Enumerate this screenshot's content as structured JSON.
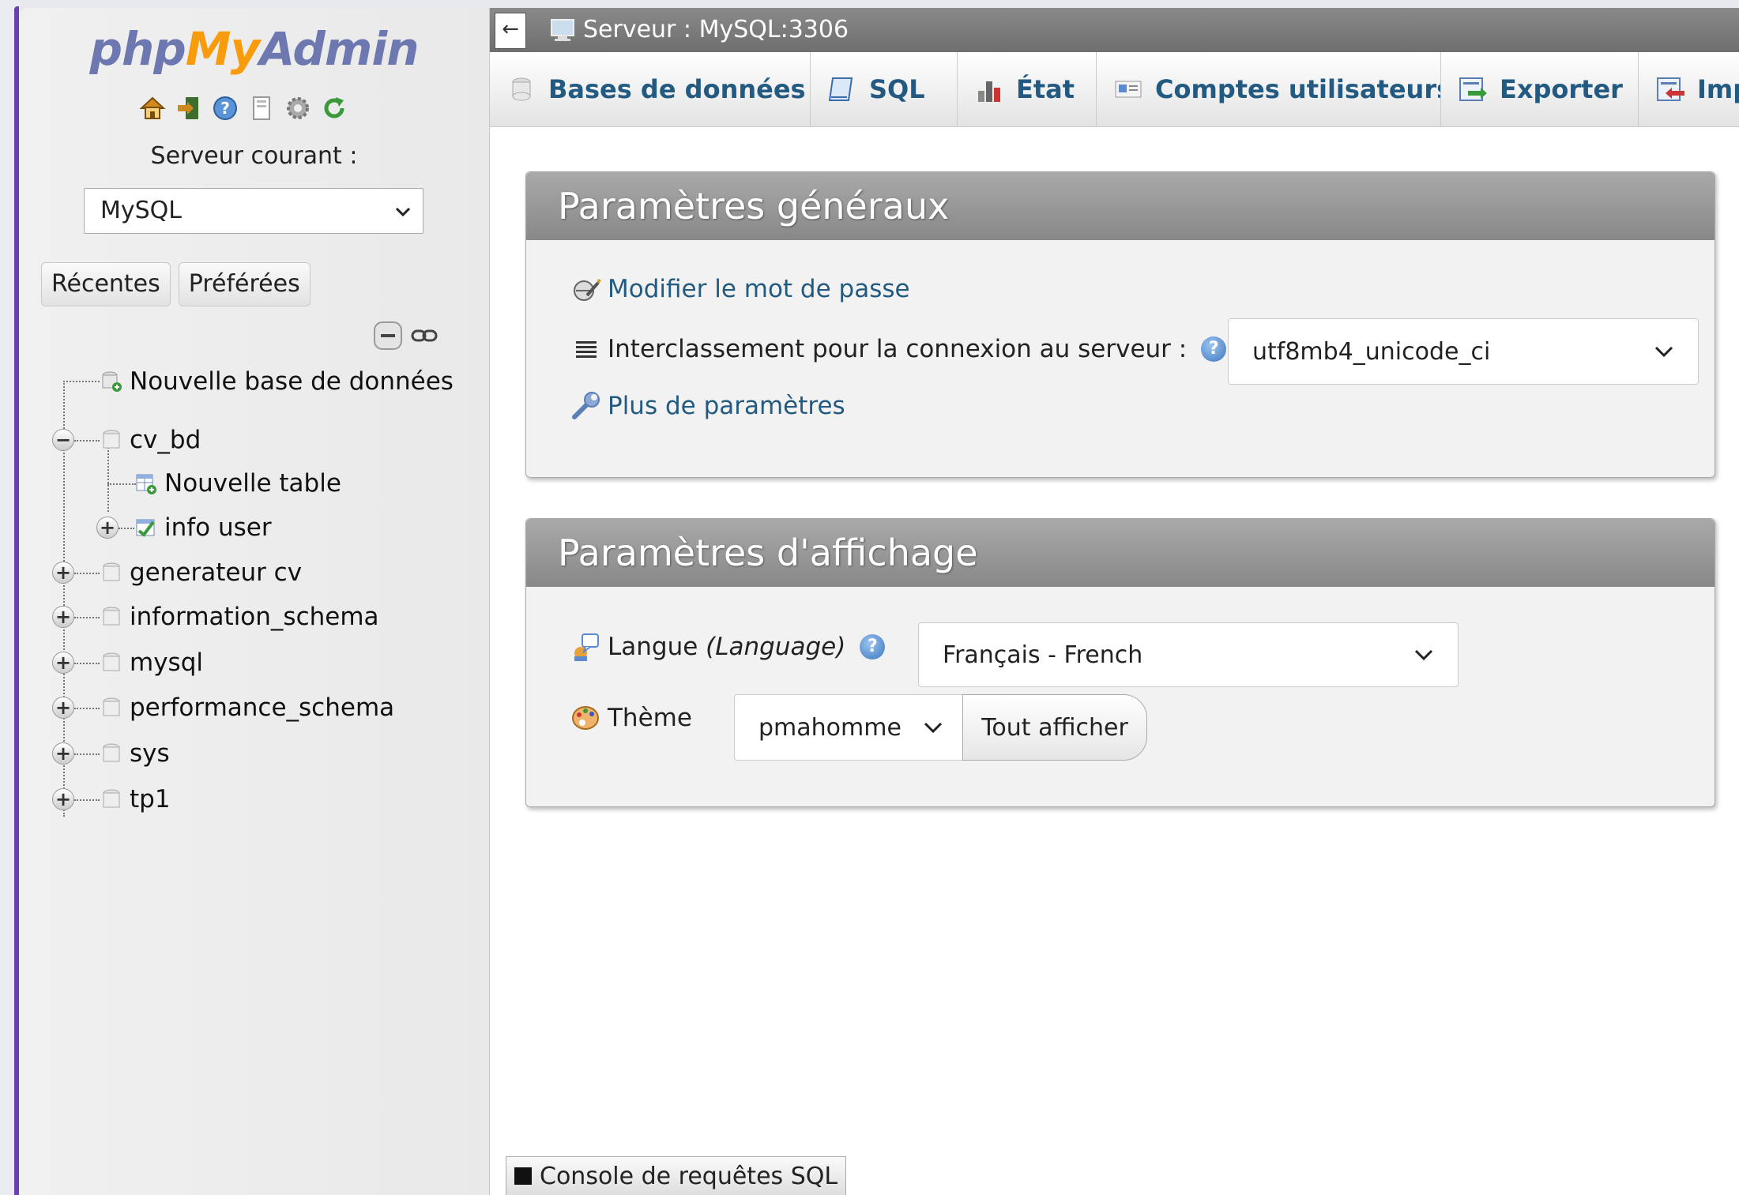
{
  "logo": {
    "part1": "php",
    "part2": "My",
    "part3": "Admin"
  },
  "quick_icons": [
    "home-icon",
    "exit-icon",
    "help-icon",
    "docs-icon",
    "settings-icon",
    "reload-icon"
  ],
  "nav": {
    "server_label": "Serveur courant :",
    "server_select": "MySQL",
    "tab_recent": "Récentes",
    "tab_favorites": "Préférées",
    "tree": {
      "new_db": "Nouvelle base de données",
      "cv_bd": "cv_bd",
      "new_table": "Nouvelle table",
      "info_user": "info user",
      "generateur_cv": "generateur cv",
      "information_schema": "information_schema",
      "mysql": "mysql",
      "performance_schema": "performance_schema",
      "sys": "sys",
      "tp1": "tp1"
    }
  },
  "topbar": {
    "back": "←",
    "server": "Serveur : MySQL:3306"
  },
  "menu": {
    "databases": "Bases de données",
    "sql": "SQL",
    "status": "État",
    "accounts": "Comptes utilisateurs",
    "export": "Exporter",
    "import": "Importer"
  },
  "general": {
    "title": "Paramètres généraux",
    "change_password": "Modifier le mot de passe",
    "collation_label": "Interclassement pour la connexion au serveur :",
    "collation_value": "utf8mb4_unicode_ci",
    "more_settings": "Plus de paramètres"
  },
  "display": {
    "title": "Paramètres d'affichage",
    "language_label": "Langue",
    "language_label_en": "(Language)",
    "language_value": "Français - French",
    "theme_label": "Thème",
    "theme_value": "pmahomme",
    "show_all": "Tout afficher"
  },
  "console": {
    "label": "Console de requêtes SQL"
  },
  "colors": {
    "link": "#235a81",
    "accent": "#6b3fb0",
    "logo_blue": "#6c78af",
    "logo_orange": "#f89c0e"
  }
}
